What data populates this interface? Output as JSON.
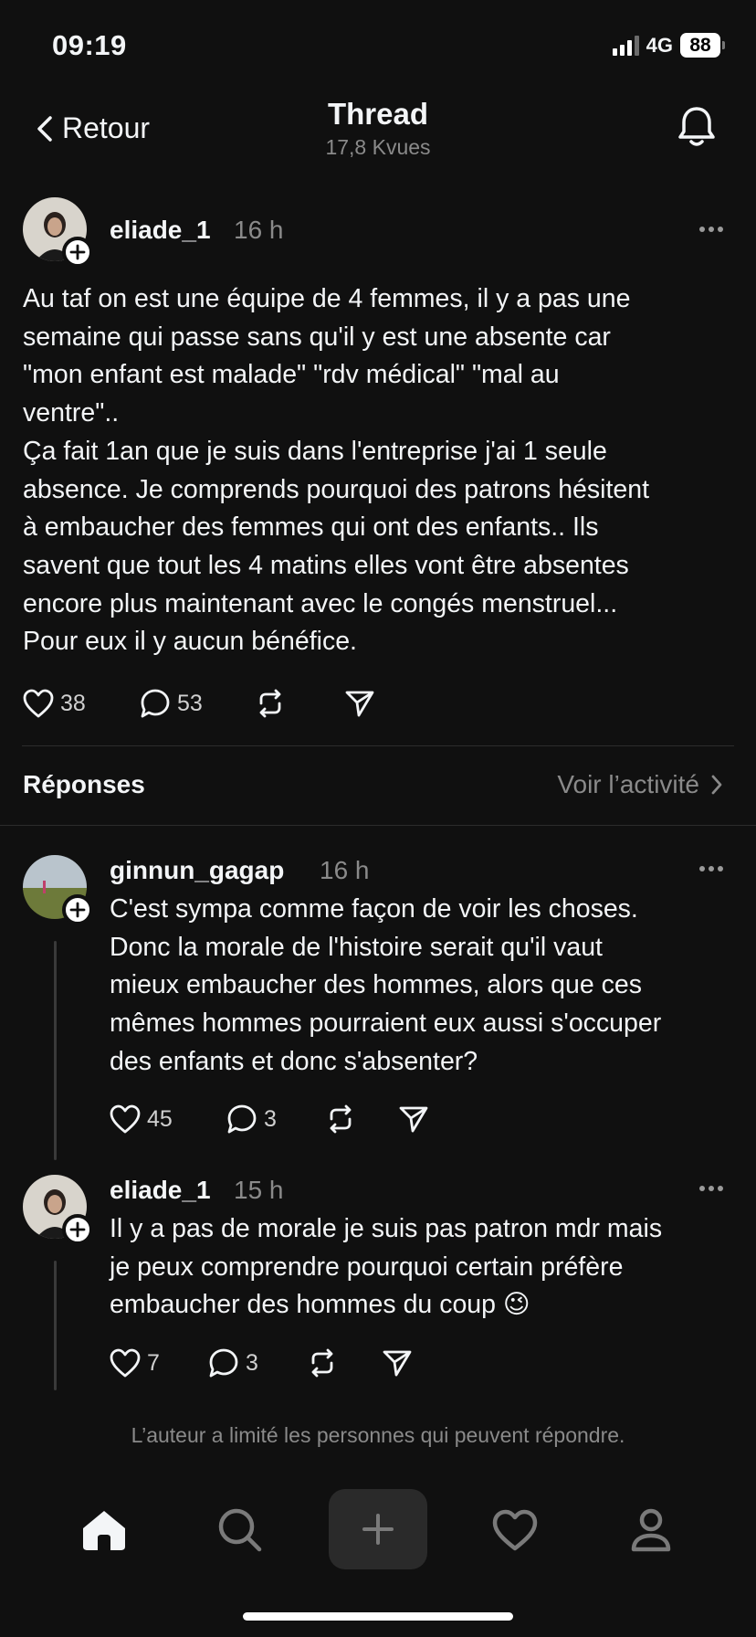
{
  "status_bar": {
    "time": "09:19",
    "network": "4G",
    "battery": "88"
  },
  "nav": {
    "back_label": "Retour",
    "title": "Thread",
    "views": "17,8 Kvues"
  },
  "main_post": {
    "username": "eliade_1",
    "time": "16 h",
    "lines": [
      "Au taf on est une équipe de 4 femmes, il y a pas une",
      "semaine qui passe sans qu'il y est une absente car",
      "\"mon enfant est malade\" \"rdv médical\" \"mal au",
      "ventre\"..",
      "Ça fait 1an que je suis dans l'entreprise j'ai 1 seule",
      "absence. Je comprends pourquoi des patrons hésitent",
      "à embaucher des femmes qui ont des enfants.. Ils",
      "savent que tout les 4 matins elles vont être absentes",
      "encore plus maintenant avec le congés menstruel...",
      "Pour eux il y aucun bénéfice."
    ],
    "likes": "38",
    "comments": "53"
  },
  "replies_section": {
    "title": "Réponses",
    "activity_label": "Voir l’activité"
  },
  "replies": [
    {
      "username": "ginnun_gagap",
      "time": "16 h",
      "lines": [
        "C'est sympa comme façon de voir les choses.",
        "Donc la morale de l'histoire serait qu'il vaut",
        "mieux embaucher des hommes, alors que ces",
        "mêmes hommes pourraient eux aussi s'occuper",
        "des enfants et donc s'absenter?"
      ],
      "likes": "45",
      "comments": "3"
    },
    {
      "username": "eliade_1",
      "time": "15 h",
      "lines": [
        "Il y a pas de morale je suis pas patron mdr mais",
        "je peux comprendre pourquoi certain préfère",
        "embaucher des hommes du coup 😉"
      ],
      "likes": "7",
      "comments": "3"
    }
  ],
  "footer_note": "L’auteur a limité les personnes qui peuvent répondre.",
  "tabs": [
    "home-icon",
    "search-icon",
    "create-icon",
    "heart-icon",
    "profile-icon"
  ],
  "colors": {
    "background": "#101010",
    "text": "#f3f5f7",
    "muted": "#8a8a8a"
  }
}
